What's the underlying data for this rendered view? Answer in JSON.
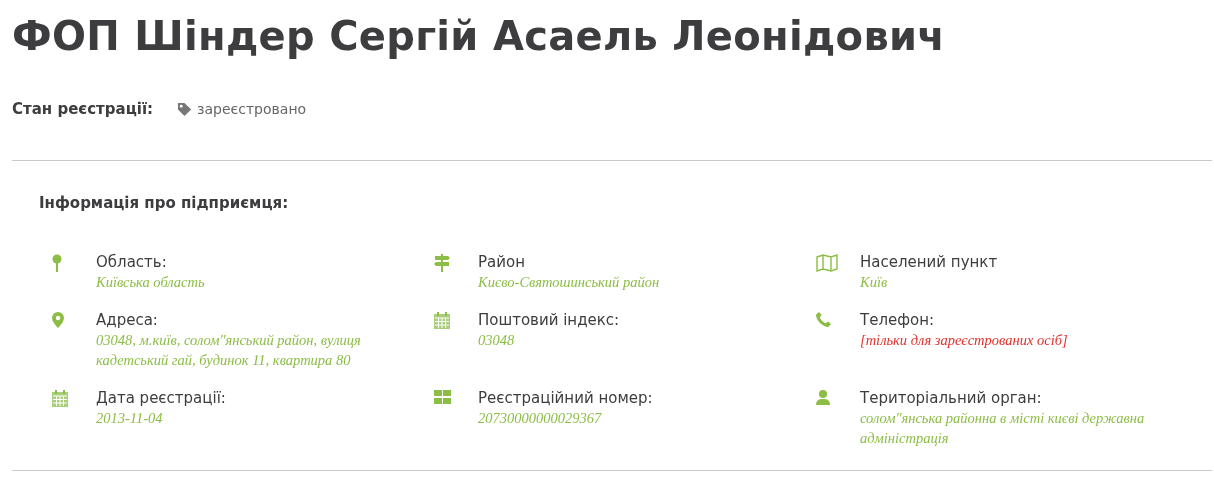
{
  "title": "ФОП Шіндер Сергій Асаель Леонідович",
  "status": {
    "label": "Стан реєстрації:",
    "value": "зареєстровано"
  },
  "section_title": "Інформація про підприємця:",
  "fields": [
    {
      "label": "Область:",
      "value": "Київська область",
      "kind": "text"
    },
    {
      "label": "Район",
      "value": "Києво-Святошинський район",
      "kind": "text"
    },
    {
      "label": "Населений пункт",
      "value": "Київ",
      "kind": "text"
    },
    {
      "label": "Адреса:",
      "value": "03048, м.київ, солом\"янський район, вулиця кадетський гай, будинок 11, квартира 80",
      "kind": "text"
    },
    {
      "label": "Поштовий індекс:",
      "value": "03048",
      "kind": "text"
    },
    {
      "label": "Телефон:",
      "value": "[тільки для зареєстрованих осіб]",
      "kind": "restricted"
    },
    {
      "label": "Дата реєстрації:",
      "value": "2013-11-04",
      "kind": "text"
    },
    {
      "label": "Реєстраційний номер:",
      "value": "20730000000029367",
      "kind": "text"
    },
    {
      "label": "Територіальний орган:",
      "value": "солом\"янська районна в місті києві державна адміністрація",
      "kind": "text"
    }
  ]
}
